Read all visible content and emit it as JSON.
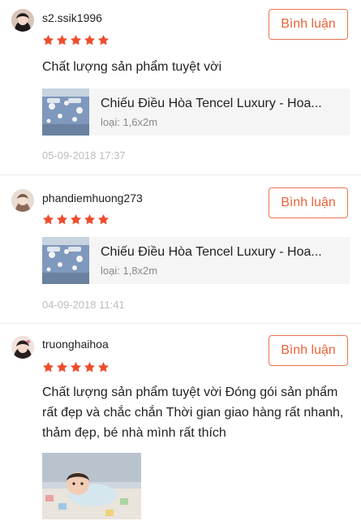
{
  "reviews": [
    {
      "username": "s2.ssik1996",
      "reply_label": "Bình luận",
      "rating": 5,
      "comment": "Chất lượng sản phẩm tuyệt vời",
      "product": {
        "title": "Chiếu Điều Hòa Tencel Luxury - Hoa...",
        "variant": "loại: 1,6x2m"
      },
      "date": "05-09-2018 17:37"
    },
    {
      "username": "phandiemhuong273",
      "reply_label": "Bình luận",
      "rating": 5,
      "product": {
        "title": "Chiếu Điều Hòa Tencel Luxury - Hoa...",
        "variant": "loại: 1,8x2m"
      },
      "date": "04-09-2018 11:41"
    },
    {
      "username": "truonghaihoa",
      "reply_label": "Bình luận",
      "rating": 5,
      "comment": "Chất lượng sản phẩm tuyệt vời Đóng gói sản phẩm rất đẹp và chắc chắn Thời gian giao hàng rất nhanh, thảm đẹp, bé nhà mình rất thích"
    }
  ],
  "colors": {
    "accent": "#e8633a",
    "star": "#ee4d2d",
    "muted": "#bdbdbd"
  }
}
